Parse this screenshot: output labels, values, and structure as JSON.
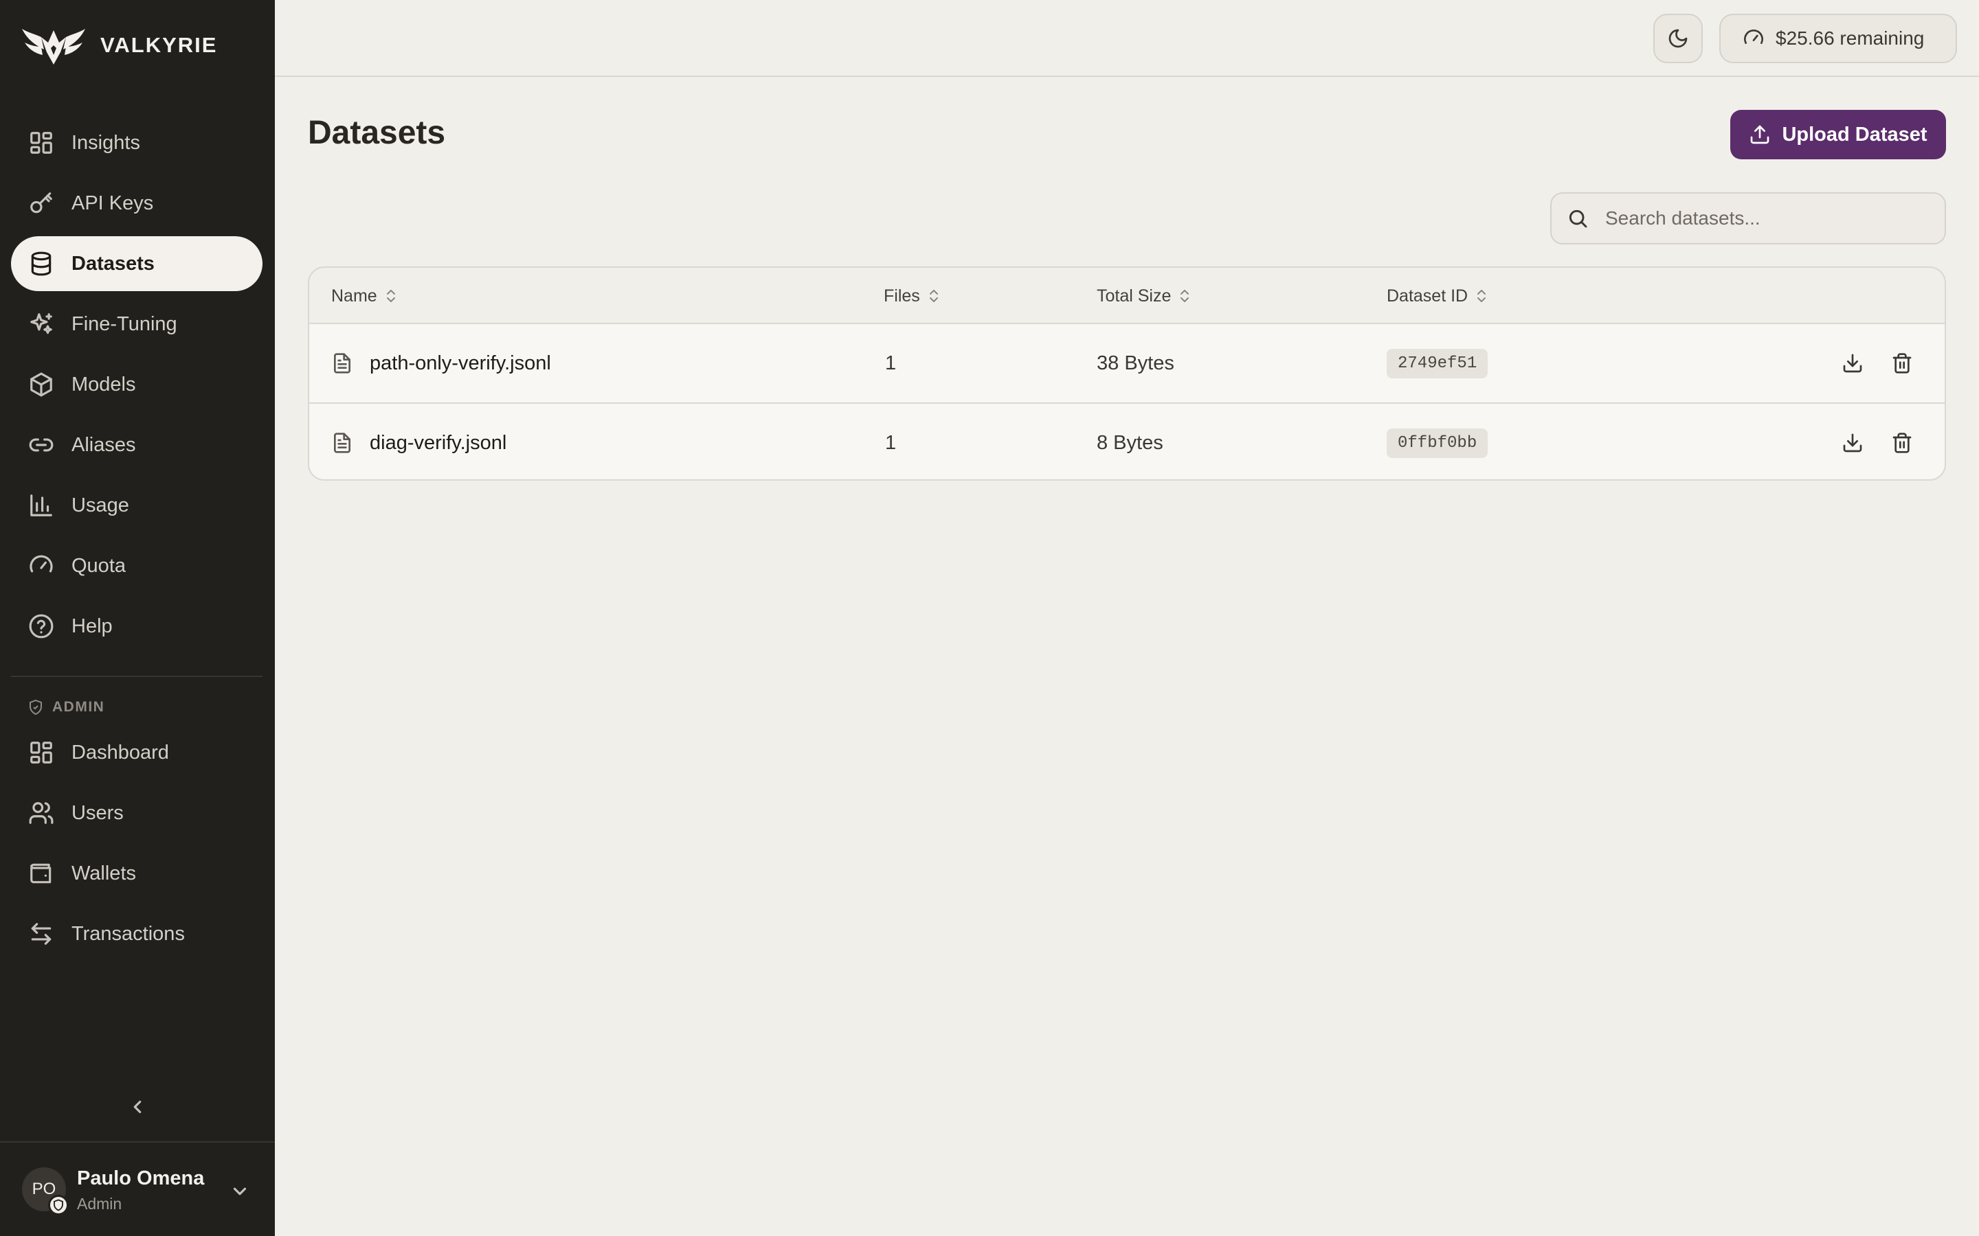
{
  "brand": {
    "name": "VALKYRIE"
  },
  "sidebar": {
    "items": [
      {
        "label": "Insights",
        "icon": "grid-icon"
      },
      {
        "label": "API Keys",
        "icon": "key-icon"
      },
      {
        "label": "Datasets",
        "icon": "database-icon",
        "active": true
      },
      {
        "label": "Fine-Tuning",
        "icon": "sparkles-icon"
      },
      {
        "label": "Models",
        "icon": "cube-icon"
      },
      {
        "label": "Aliases",
        "icon": "link-icon"
      },
      {
        "label": "Usage",
        "icon": "bar-chart-icon"
      },
      {
        "label": "Quota",
        "icon": "gauge-icon"
      },
      {
        "label": "Help",
        "icon": "help-circle-icon"
      }
    ],
    "admin_label": "ADMIN",
    "admin_items": [
      {
        "label": "Dashboard",
        "icon": "grid-icon"
      },
      {
        "label": "Users",
        "icon": "users-icon"
      },
      {
        "label": "Wallets",
        "icon": "wallet-icon"
      },
      {
        "label": "Transactions",
        "icon": "arrows-left-right-icon"
      }
    ]
  },
  "user": {
    "initials": "PO",
    "name": "Paulo Omena",
    "role": "Admin"
  },
  "topbar": {
    "balance": "$25.66 remaining"
  },
  "page": {
    "title": "Datasets",
    "upload_label": "Upload Dataset",
    "search_placeholder": "Search datasets..."
  },
  "table": {
    "columns": [
      "Name",
      "Files",
      "Total Size",
      "Dataset ID"
    ],
    "rows": [
      {
        "name": "path-only-verify.jsonl",
        "files": "1",
        "size": "38 Bytes",
        "id": "2749ef51"
      },
      {
        "name": "diag-verify.jsonl",
        "files": "1",
        "size": "8 Bytes",
        "id": "0ffbf0bb"
      }
    ]
  },
  "colors": {
    "sidebar_bg": "#22201c",
    "accent": "#5b2d6b",
    "page_bg": "#f1efea"
  }
}
